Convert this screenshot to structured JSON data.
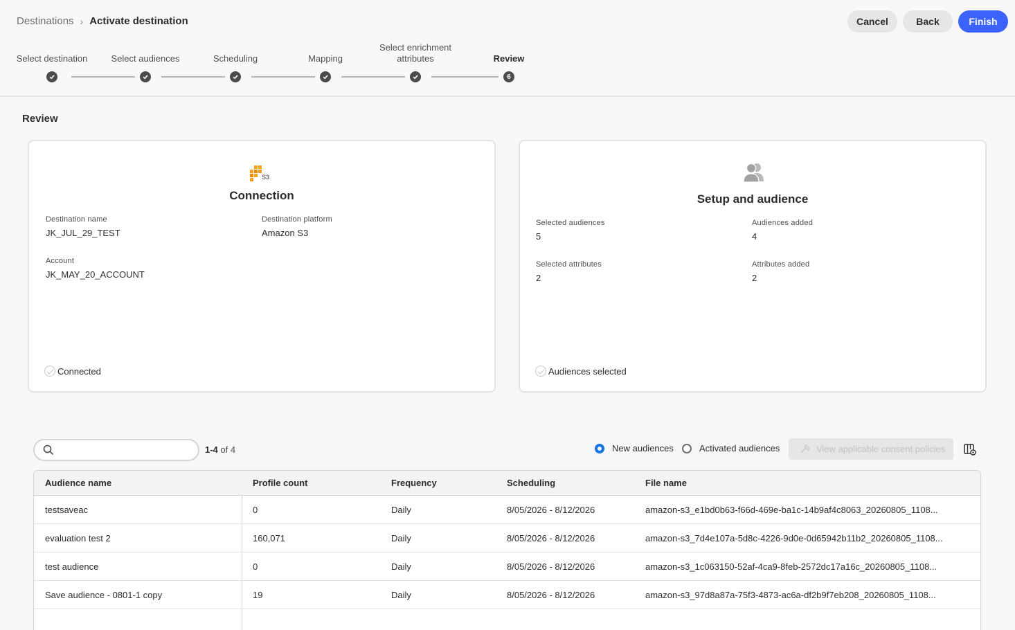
{
  "breadcrumb": {
    "root": "Destinations",
    "separator": "›",
    "current": "Activate destination"
  },
  "actions": {
    "cancel": "Cancel",
    "back": "Back",
    "finish": "Finish"
  },
  "steps": [
    {
      "label": "Select destination",
      "state": "done"
    },
    {
      "label": "Select audiences",
      "state": "done"
    },
    {
      "label": "Scheduling",
      "state": "done"
    },
    {
      "label": "Mapping",
      "state": "done"
    },
    {
      "label": "Select enrichment attributes",
      "state": "done"
    },
    {
      "label": "Review",
      "state": "active",
      "number": "6"
    }
  ],
  "review": {
    "title": "Review",
    "connection": {
      "logo_text": "S3",
      "title": "Connection",
      "destination_name_label": "Destination name",
      "destination_name": "JK_JUL_29_TEST",
      "platform_label": "Destination platform",
      "platform": "Amazon S3",
      "account_label": "Account",
      "account": "JK_MAY_20_ACCOUNT",
      "status": "Connected"
    },
    "setup": {
      "title": "Setup and audience",
      "selected_audiences_label": "Selected audiences",
      "selected_audiences": "5",
      "audiences_added_label": "Audiences added",
      "audiences_added": "4",
      "selected_attributes_label": "Selected attributes",
      "selected_attributes": "2",
      "attributes_added_label": "Attributes added",
      "attributes_added": "2",
      "status": "Audiences selected"
    }
  },
  "toolbar": {
    "search_placeholder": "",
    "count_range": "1-4",
    "count_rest": " of 4",
    "radio_new": "New audiences",
    "radio_activated": "Activated audiences",
    "consent_button": "View applicable consent policies"
  },
  "table": {
    "headers": [
      "Audience name",
      "Profile count",
      "Frequency",
      "Scheduling",
      "File name"
    ],
    "rows": [
      [
        "testsaveac",
        "0",
        "Daily",
        "8/05/2026 - 8/12/2026",
        "amazon-s3_e1bd0b63-f66d-469e-ba1c-14b9af4c8063_20260805_1108..."
      ],
      [
        "evaluation test 2",
        "160,071",
        "Daily",
        "8/05/2026 - 8/12/2026",
        "amazon-s3_7d4e107a-5d8c-4226-9d0e-0d65942b11b2_20260805_1108..."
      ],
      [
        "test audience",
        "0",
        "Daily",
        "8/05/2026 - 8/12/2026",
        "amazon-s3_1c063150-52af-4ca9-8feb-2572dc17a16c_20260805_1108..."
      ],
      [
        "Save audience - 0801-1 copy",
        "19",
        "Daily",
        "8/05/2026 - 8/12/2026",
        "amazon-s3_97d8a87a-75f3-4873-ac6a-df2b9f7eb208_20260805_1108..."
      ]
    ]
  },
  "colors": {
    "accent": "#3b63fb",
    "radio_selected": "#1473e6",
    "step_dot": "#4b4b4b",
    "s3_orange": "#f7a21b"
  }
}
